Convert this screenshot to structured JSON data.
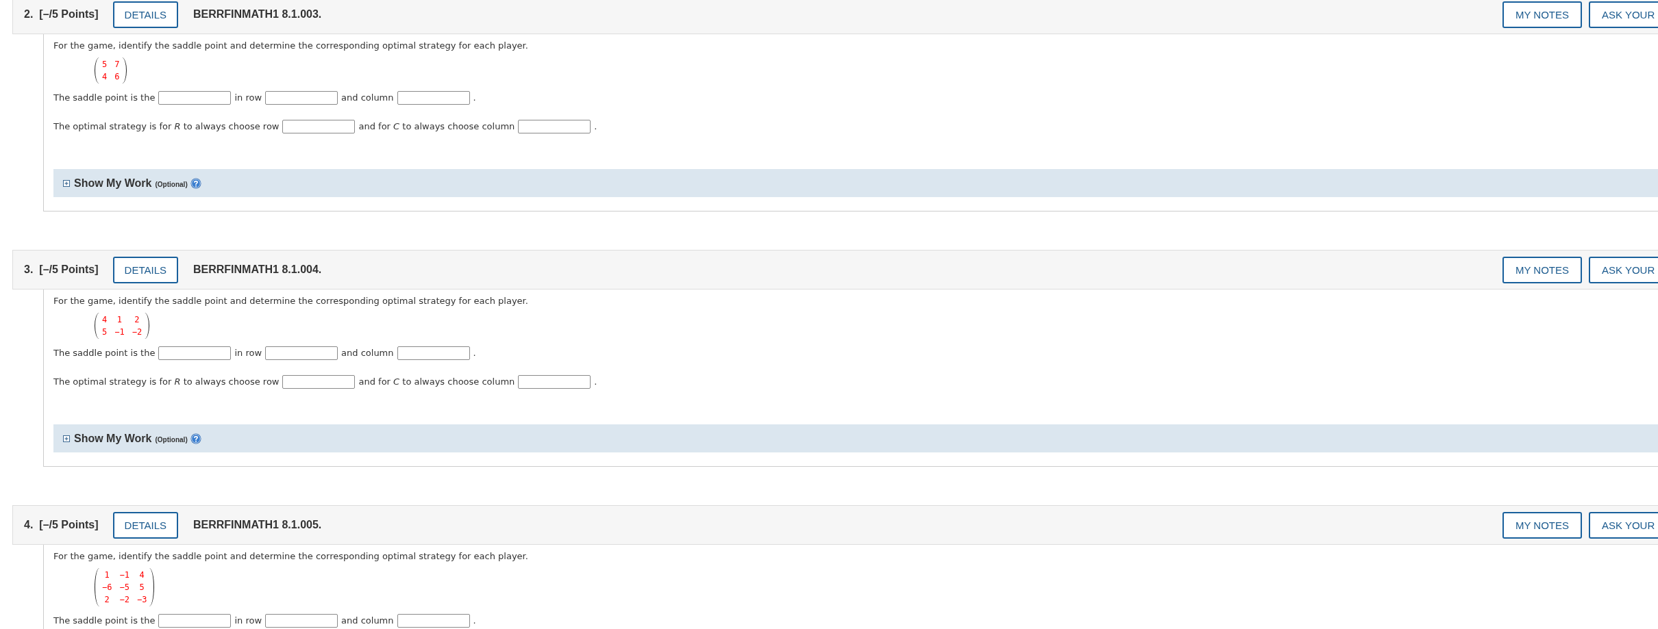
{
  "questions": [
    {
      "number": "2.",
      "points": "[–/5 Points]",
      "details_button": "DETAILS",
      "code": "BERRFINMATH1 8.1.003.",
      "notes_button": "MY NOTES",
      "ask_button": "ASK YOUR",
      "prompt": "For the game, identify the saddle point and determine the corresponding optimal strategy for each player.",
      "matrix": [
        [
          "5",
          "7"
        ],
        [
          "4",
          "6"
        ]
      ],
      "answer_lines": [
        [
          {
            "kind": "text",
            "text": "The saddle point is the"
          },
          {
            "kind": "blank"
          },
          {
            "kind": "text",
            "text": "in row"
          },
          {
            "kind": "blank"
          },
          {
            "kind": "text",
            "text": "and column"
          },
          {
            "kind": "blank"
          },
          {
            "kind": "text",
            "text": "."
          }
        ],
        [
          {
            "kind": "text",
            "text": "The optimal strategy is for *R* to always choose row"
          },
          {
            "kind": "blank"
          },
          {
            "kind": "text",
            "text": "and for *C* to always choose column"
          },
          {
            "kind": "blank"
          },
          {
            "kind": "text",
            "text": "."
          }
        ]
      ],
      "show_my_work": {
        "label": "Show My Work",
        "note": "(Optional)",
        "expanded": false
      }
    },
    {
      "number": "3.",
      "points": "[–/5 Points]",
      "details_button": "DETAILS",
      "code": "BERRFINMATH1 8.1.004.",
      "notes_button": "MY NOTES",
      "ask_button": "ASK YOUR",
      "prompt": "For the game, identify the saddle point and determine the corresponding optimal strategy for each player.",
      "matrix": [
        [
          "4",
          "1",
          "2"
        ],
        [
          "5",
          "−1",
          "−2"
        ]
      ],
      "answer_lines": [
        [
          {
            "kind": "text",
            "text": "The saddle point is the"
          },
          {
            "kind": "blank"
          },
          {
            "kind": "text",
            "text": "in row"
          },
          {
            "kind": "blank"
          },
          {
            "kind": "text",
            "text": "and column"
          },
          {
            "kind": "blank"
          },
          {
            "kind": "text",
            "text": "."
          }
        ],
        [
          {
            "kind": "text",
            "text": "The optimal strategy is for *R* to always choose row"
          },
          {
            "kind": "blank"
          },
          {
            "kind": "text",
            "text": "and for *C* to always choose column"
          },
          {
            "kind": "blank"
          },
          {
            "kind": "text",
            "text": "."
          }
        ]
      ],
      "show_my_work": {
        "label": "Show My Work",
        "note": "(Optional)",
        "expanded": false
      }
    },
    {
      "number": "4.",
      "points": "[–/5 Points]",
      "details_button": "DETAILS",
      "code": "BERRFINMATH1 8.1.005.",
      "notes_button": "MY NOTES",
      "ask_button": "ASK YOUR",
      "prompt": "For the game, identify the saddle point and determine the corresponding optimal strategy for each player.",
      "matrix": [
        [
          "1",
          "−1",
          "4"
        ],
        [
          "−6",
          "−5",
          "5"
        ],
        [
          "2",
          "−2",
          "−3"
        ]
      ],
      "answer_lines": [
        [
          {
            "kind": "text",
            "text": "The saddle point is the"
          },
          {
            "kind": "blank"
          },
          {
            "kind": "text",
            "text": "in row"
          },
          {
            "kind": "blank"
          },
          {
            "kind": "text",
            "text": "and column"
          },
          {
            "kind": "blank"
          },
          {
            "kind": "text",
            "text": "."
          }
        ]
      ]
    }
  ]
}
